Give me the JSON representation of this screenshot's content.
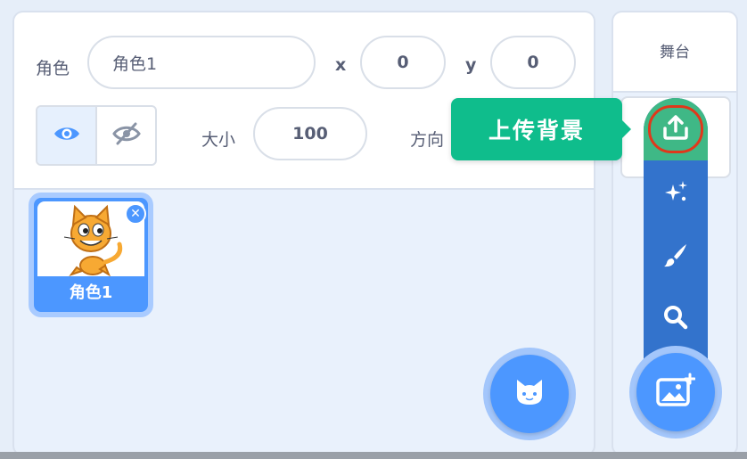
{
  "sprite_info": {
    "sprite_label": "角色",
    "sprite_name_value": "角色1",
    "x_label": "x",
    "x_value": "0",
    "y_label": "y",
    "y_value": "0",
    "size_label": "大小",
    "size_value": "100",
    "direction_label": "方向"
  },
  "sprite_list": {
    "items": [
      {
        "name": "角色1",
        "delete_symbol": "✕"
      }
    ]
  },
  "stage": {
    "title": "舞台"
  },
  "backdrop_menu": {
    "tooltip": "上传背景",
    "items": [
      "upload-icon",
      "surprise-icon",
      "paint-icon",
      "search-icon"
    ]
  },
  "icons": {
    "show_visible": "eye-icon",
    "hide_visible": "eye-slash-icon",
    "add_sprite": "cat-icon",
    "add_backdrop": "image-icon"
  },
  "colors": {
    "accent_blue": "#4c97ff",
    "menu_blue": "#3373cc",
    "tooltip_green": "#0fbd8c",
    "upload_green": "#3fb886",
    "highlight_red": "#e0381b"
  }
}
